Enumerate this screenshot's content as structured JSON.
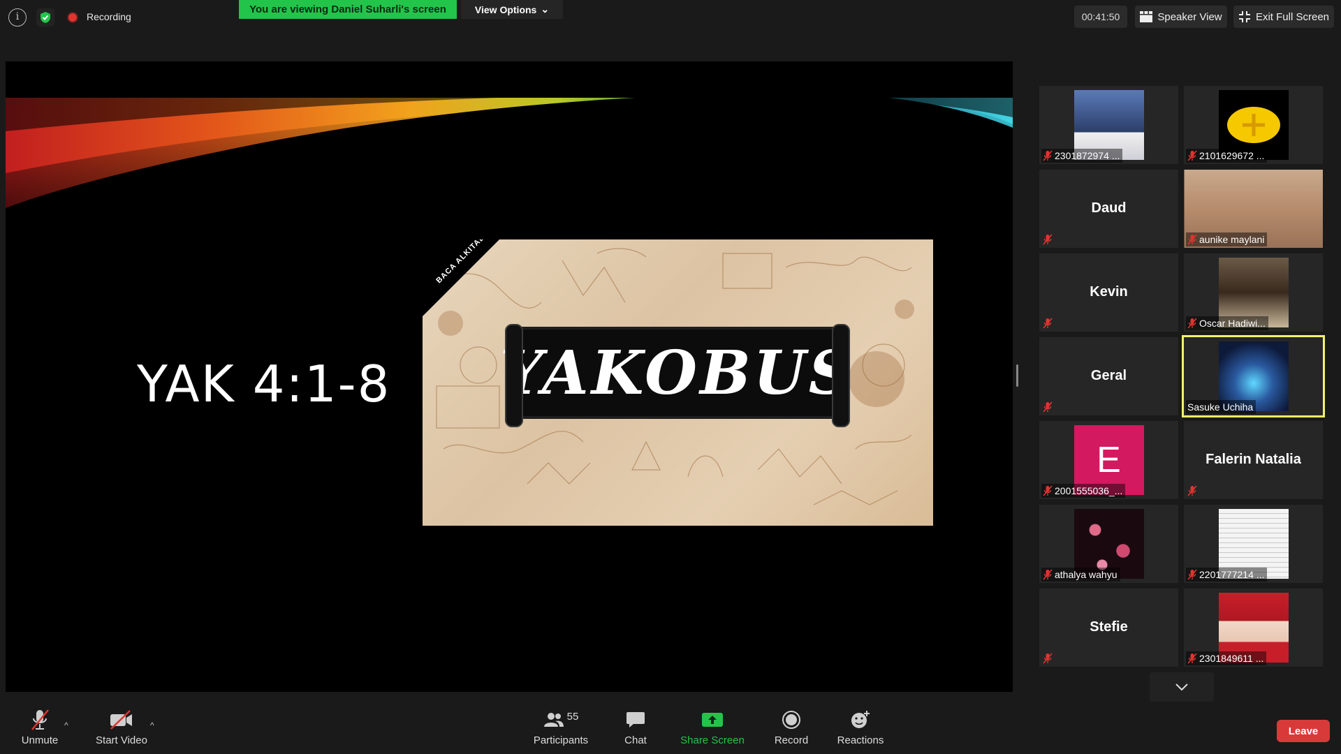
{
  "topbar": {
    "recording_label": "Recording",
    "viewing_banner": "You are viewing Daniel Suharli's screen",
    "view_options_label": "View Options",
    "timer": "00:41:50",
    "speaker_view_label": "Speaker View",
    "exit_fullscreen_label": "Exit Full Screen"
  },
  "shared_screen": {
    "slide_title": "YAK 4:1-8",
    "image_corner_text": "BACA ALKITAB",
    "image_title": "YAKOBUS"
  },
  "participants": [
    {
      "label": "2301872974 ...",
      "type": "video",
      "muted": true
    },
    {
      "label": "2101629672 ...",
      "type": "video",
      "muted": true
    },
    {
      "label": "",
      "big_name": "Daud",
      "type": "name",
      "muted": true
    },
    {
      "label": "aunike maylani",
      "type": "video",
      "muted": true
    },
    {
      "label": "",
      "big_name": "Kevin",
      "type": "name",
      "muted": true
    },
    {
      "label": "Oscar Hadiwi...",
      "type": "video",
      "muted": true
    },
    {
      "label": "",
      "big_name": "Geral",
      "type": "name",
      "muted": true
    },
    {
      "label": "Sasuke Uchiha",
      "type": "video",
      "muted": false,
      "active_speaker": true
    },
    {
      "label": "2001555036_...",
      "type": "avatar",
      "avatar_letter": "E",
      "muted": true
    },
    {
      "label": "",
      "big_name": "Falerin Natalia",
      "type": "name",
      "muted": true
    },
    {
      "label": "athalya wahyu",
      "type": "video",
      "muted": true
    },
    {
      "label": "2201777214 ...",
      "type": "video",
      "muted": true
    },
    {
      "label": "",
      "big_name": "Stefie",
      "type": "name",
      "muted": true
    },
    {
      "label": "2301849611 ...",
      "type": "video",
      "muted": true
    }
  ],
  "toolbar": {
    "unmute_label": "Unmute",
    "start_video_label": "Start Video",
    "participants_label": "Participants",
    "participants_count": "55",
    "chat_label": "Chat",
    "share_screen_label": "Share Screen",
    "record_label": "Record",
    "reactions_label": "Reactions",
    "leave_label": "Leave"
  },
  "colors": {
    "share_green": "#23c44a",
    "leave_red": "#d83a3a",
    "active_speaker": "#f1f26a"
  }
}
